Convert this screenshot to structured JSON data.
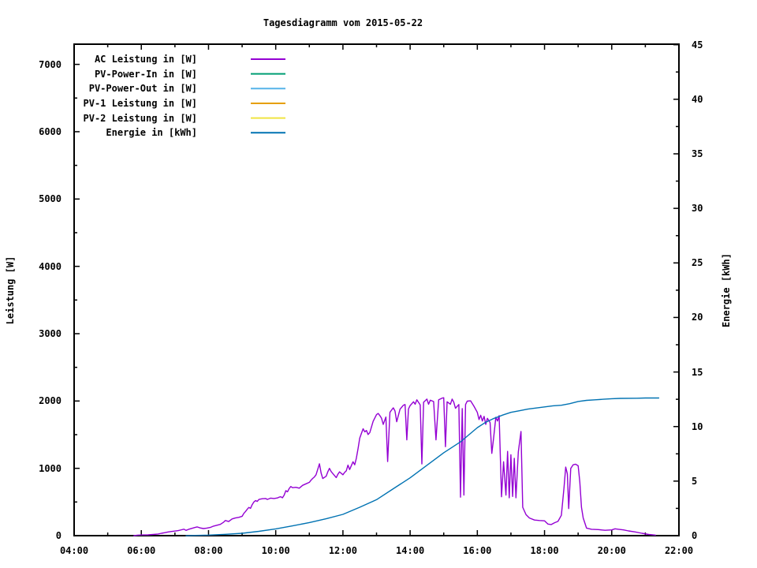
{
  "title": "Tagesdiagramm vom 2015-05-22",
  "chart_data": {
    "type": "line",
    "title": "Tagesdiagramm vom 2015-05-22",
    "xlabel": "",
    "ylabel_left": "Leistung [W]",
    "ylabel_right": "Energie [kWh]",
    "grid": false,
    "legend_position": "top-left-inside",
    "x_axis": {
      "unit": "time",
      "min": 4,
      "max": 22,
      "major_step_hours": 2,
      "minor_step_hours": 1,
      "tick_hours": [
        4,
        6,
        8,
        10,
        12,
        14,
        16,
        18,
        20,
        22
      ],
      "tick_labels": [
        "04:00",
        "06:00",
        "08:00",
        "10:00",
        "12:00",
        "14:00",
        "16:00",
        "18:00",
        "20:00",
        "22:00"
      ]
    },
    "y_left": {
      "label": "Leistung [W]",
      "min": 0,
      "max": 7300,
      "major_step": 1000,
      "minor_step": 500,
      "tick_values": [
        0,
        1000,
        2000,
        3000,
        4000,
        5000,
        6000,
        7000
      ],
      "tick_labels": [
        "0",
        "1000",
        "2000",
        "3000",
        "4000",
        "5000",
        "6000",
        "7000"
      ]
    },
    "y_right": {
      "label": "Energie [kWh]",
      "min": 0,
      "max": 45.05,
      "major_step": 5,
      "minor_step": 2.5,
      "tick_values": [
        0,
        5,
        10,
        15,
        20,
        25,
        30,
        35,
        40,
        45
      ],
      "tick_labels": [
        "0",
        "5",
        "10",
        "15",
        "20",
        "25",
        "30",
        "35",
        "40",
        "45"
      ]
    },
    "series": [
      {
        "name": "AC Leistung in [W]",
        "color": "#9400D3",
        "axis": "left",
        "points": [
          [
            5.78,
            0
          ],
          [
            5.9,
            8
          ],
          [
            6.05,
            10
          ],
          [
            6.2,
            12
          ],
          [
            6.35,
            18
          ],
          [
            6.5,
            25
          ],
          [
            6.6,
            35
          ],
          [
            6.7,
            45
          ],
          [
            6.8,
            55
          ],
          [
            6.9,
            62
          ],
          [
            7.0,
            68
          ],
          [
            7.1,
            75
          ],
          [
            7.2,
            88
          ],
          [
            7.27,
            96
          ],
          [
            7.33,
            78
          ],
          [
            7.4,
            92
          ],
          [
            7.5,
            108
          ],
          [
            7.6,
            122
          ],
          [
            7.66,
            130
          ],
          [
            7.75,
            115
          ],
          [
            7.85,
            105
          ],
          [
            7.95,
            112
          ],
          [
            8.05,
            122
          ],
          [
            8.15,
            142
          ],
          [
            8.25,
            155
          ],
          [
            8.35,
            168
          ],
          [
            8.45,
            200
          ],
          [
            8.5,
            225
          ],
          [
            8.6,
            210
          ],
          [
            8.7,
            248
          ],
          [
            8.8,
            262
          ],
          [
            8.9,
            272
          ],
          [
            9.0,
            288
          ],
          [
            9.05,
            330
          ],
          [
            9.1,
            358
          ],
          [
            9.15,
            390
          ],
          [
            9.2,
            420
          ],
          [
            9.25,
            405
          ],
          [
            9.3,
            460
          ],
          [
            9.35,
            500
          ],
          [
            9.4,
            522
          ],
          [
            9.45,
            508
          ],
          [
            9.5,
            538
          ],
          [
            9.6,
            548
          ],
          [
            9.7,
            552
          ],
          [
            9.75,
            538
          ],
          [
            9.85,
            558
          ],
          [
            9.95,
            552
          ],
          [
            10.05,
            560
          ],
          [
            10.1,
            572
          ],
          [
            10.15,
            578
          ],
          [
            10.2,
            562
          ],
          [
            10.25,
            600
          ],
          [
            10.3,
            668
          ],
          [
            10.35,
            652
          ],
          [
            10.4,
            700
          ],
          [
            10.45,
            730
          ],
          [
            10.5,
            712
          ],
          [
            10.6,
            718
          ],
          [
            10.7,
            705
          ],
          [
            10.8,
            748
          ],
          [
            10.9,
            770
          ],
          [
            11.0,
            792
          ],
          [
            11.05,
            824
          ],
          [
            11.1,
            850
          ],
          [
            11.15,
            872
          ],
          [
            11.2,
            905
          ],
          [
            11.3,
            1068
          ],
          [
            11.35,
            932
          ],
          [
            11.4,
            848
          ],
          [
            11.5,
            882
          ],
          [
            11.55,
            948
          ],
          [
            11.6,
            1000
          ],
          [
            11.65,
            952
          ],
          [
            11.7,
            922
          ],
          [
            11.8,
            862
          ],
          [
            11.85,
            912
          ],
          [
            11.9,
            948
          ],
          [
            12.0,
            905
          ],
          [
            12.05,
            938
          ],
          [
            12.1,
            962
          ],
          [
            12.15,
            1048
          ],
          [
            12.2,
            982
          ],
          [
            12.3,
            1098
          ],
          [
            12.35,
            1052
          ],
          [
            12.4,
            1150
          ],
          [
            12.45,
            1295
          ],
          [
            12.5,
            1448
          ],
          [
            12.55,
            1518
          ],
          [
            12.6,
            1588
          ],
          [
            12.65,
            1542
          ],
          [
            12.7,
            1562
          ],
          [
            12.75,
            1502
          ],
          [
            12.8,
            1532
          ],
          [
            12.9,
            1698
          ],
          [
            13.0,
            1798
          ],
          [
            13.05,
            1815
          ],
          [
            13.1,
            1782
          ],
          [
            13.15,
            1742
          ],
          [
            13.2,
            1652
          ],
          [
            13.28,
            1762
          ],
          [
            13.33,
            1100
          ],
          [
            13.4,
            1832
          ],
          [
            13.45,
            1868
          ],
          [
            13.5,
            1898
          ],
          [
            13.55,
            1852
          ],
          [
            13.6,
            1692
          ],
          [
            13.7,
            1878
          ],
          [
            13.8,
            1938
          ],
          [
            13.85,
            1948
          ],
          [
            13.9,
            1422
          ],
          [
            13.95,
            1882
          ],
          [
            14.0,
            1932
          ],
          [
            14.1,
            1988
          ],
          [
            14.15,
            1952
          ],
          [
            14.2,
            2018
          ],
          [
            14.3,
            1942
          ],
          [
            14.35,
            1065
          ],
          [
            14.4,
            1982
          ],
          [
            14.5,
            2028
          ],
          [
            14.55,
            1952
          ],
          [
            14.6,
            2012
          ],
          [
            14.7,
            1992
          ],
          [
            14.77,
            1422
          ],
          [
            14.85,
            2018
          ],
          [
            14.95,
            2042
          ],
          [
            15.0,
            2048
          ],
          [
            15.05,
            1322
          ],
          [
            15.1,
            1988
          ],
          [
            15.2,
            1952
          ],
          [
            15.25,
            2028
          ],
          [
            15.3,
            1982
          ],
          [
            15.35,
            1892
          ],
          [
            15.45,
            1948
          ],
          [
            15.5,
            572
          ],
          [
            15.55,
            1888
          ],
          [
            15.6,
            602
          ],
          [
            15.65,
            1948
          ],
          [
            15.7,
            1998
          ],
          [
            15.8,
            2002
          ],
          [
            15.9,
            1922
          ],
          [
            16.0,
            1832
          ],
          [
            16.05,
            1725
          ],
          [
            16.1,
            1788
          ],
          [
            16.15,
            1702
          ],
          [
            16.2,
            1772
          ],
          [
            16.25,
            1652
          ],
          [
            16.3,
            1742
          ],
          [
            16.38,
            1680
          ],
          [
            16.43,
            1222
          ],
          [
            16.48,
            1432
          ],
          [
            16.55,
            1758
          ],
          [
            16.6,
            1702
          ],
          [
            16.65,
            1782
          ],
          [
            16.72,
            578
          ],
          [
            16.78,
            1098
          ],
          [
            16.85,
            602
          ],
          [
            16.9,
            1252
          ],
          [
            16.95,
            562
          ],
          [
            17.0,
            1202
          ],
          [
            17.05,
            582
          ],
          [
            17.1,
            1148
          ],
          [
            17.15,
            562
          ],
          [
            17.22,
            1242
          ],
          [
            17.3,
            1548
          ],
          [
            17.35,
            422
          ],
          [
            17.45,
            312
          ],
          [
            17.55,
            262
          ],
          [
            17.7,
            232
          ],
          [
            17.85,
            225
          ],
          [
            18.0,
            220
          ],
          [
            18.1,
            172
          ],
          [
            18.2,
            165
          ],
          [
            18.3,
            192
          ],
          [
            18.4,
            212
          ],
          [
            18.5,
            302
          ],
          [
            18.58,
            718
          ],
          [
            18.63,
            1018
          ],
          [
            18.68,
            918
          ],
          [
            18.72,
            402
          ],
          [
            18.78,
            998
          ],
          [
            18.85,
            1052
          ],
          [
            18.92,
            1062
          ],
          [
            19.0,
            1038
          ],
          [
            19.05,
            798
          ],
          [
            19.1,
            422
          ],
          [
            19.15,
            262
          ],
          [
            19.25,
            112
          ],
          [
            19.4,
            95
          ],
          [
            19.6,
            90
          ],
          [
            19.8,
            80
          ],
          [
            20.0,
            85
          ],
          [
            20.1,
            102
          ],
          [
            20.2,
            95
          ],
          [
            20.35,
            85
          ],
          [
            20.5,
            70
          ],
          [
            20.7,
            55
          ],
          [
            20.9,
            35
          ],
          [
            21.1,
            18
          ],
          [
            21.3,
            8
          ]
        ]
      },
      {
        "name": "PV-Power-In in [W]",
        "color": "#009E73",
        "axis": "left",
        "points": []
      },
      {
        "name": "PV-Power-Out in [W]",
        "color": "#56B4E9",
        "axis": "left",
        "points": []
      },
      {
        "name": "PV-1 Leistung in [W]",
        "color": "#E69F00",
        "axis": "left",
        "points": []
      },
      {
        "name": "PV-2 Leistung in [W]",
        "color": "#F0E442",
        "axis": "left",
        "points": []
      },
      {
        "name": "Energie in [kWh]",
        "color": "#0072B2",
        "axis": "right",
        "points": [
          [
            7.33,
            0
          ],
          [
            7.6,
            0.02
          ],
          [
            8.0,
            0.05
          ],
          [
            8.5,
            0.12
          ],
          [
            9.0,
            0.22
          ],
          [
            9.5,
            0.4
          ],
          [
            10.0,
            0.62
          ],
          [
            10.5,
            0.9
          ],
          [
            11.0,
            1.2
          ],
          [
            11.5,
            1.55
          ],
          [
            12.0,
            1.95
          ],
          [
            12.5,
            2.6
          ],
          [
            13.0,
            3.3
          ],
          [
            13.5,
            4.3
          ],
          [
            14.0,
            5.3
          ],
          [
            14.5,
            6.45
          ],
          [
            15.0,
            7.6
          ],
          [
            15.5,
            8.6
          ],
          [
            16.0,
            9.9
          ],
          [
            16.25,
            10.4
          ],
          [
            16.5,
            10.75
          ],
          [
            16.75,
            11.05
          ],
          [
            17.0,
            11.3
          ],
          [
            17.25,
            11.45
          ],
          [
            17.5,
            11.6
          ],
          [
            17.75,
            11.7
          ],
          [
            18.0,
            11.8
          ],
          [
            18.25,
            11.9
          ],
          [
            18.5,
            11.95
          ],
          [
            18.75,
            12.1
          ],
          [
            19.0,
            12.3
          ],
          [
            19.25,
            12.4
          ],
          [
            19.5,
            12.45
          ],
          [
            19.75,
            12.5
          ],
          [
            20.0,
            12.55
          ],
          [
            20.25,
            12.58
          ],
          [
            20.75,
            12.6
          ],
          [
            21.0,
            12.62
          ],
          [
            21.4,
            12.62
          ]
        ]
      }
    ]
  }
}
